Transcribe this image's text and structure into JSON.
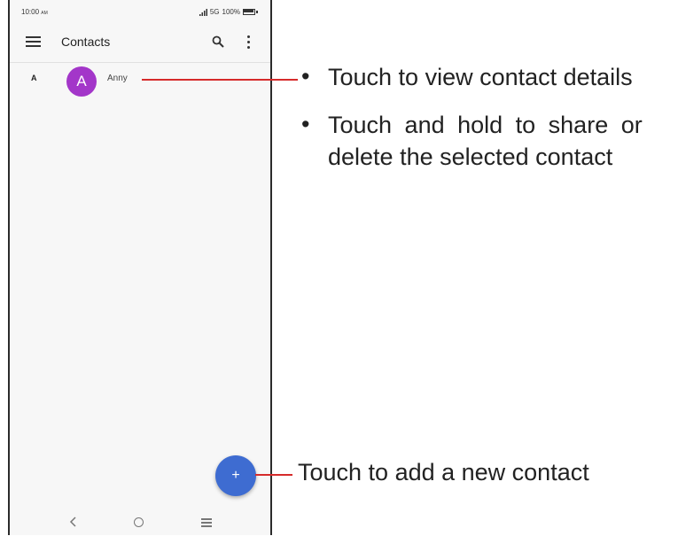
{
  "status_bar": {
    "time": "10:00",
    "time_suffix": "AM",
    "network": "5G",
    "battery": "100%"
  },
  "app_bar": {
    "title": "Contacts",
    "menu_icon": "hamburger-menu-icon",
    "search_icon": "search-icon",
    "overflow_icon": "more-vertical-icon"
  },
  "contacts": [
    {
      "section": "A",
      "initial": "A",
      "name": "Anny",
      "avatar_color": "#a336c9"
    }
  ],
  "fab": {
    "label": "+",
    "color": "#3e6cd1"
  },
  "nav_bar": {
    "back": "‹",
    "home_icon": "home-circle-icon",
    "recents_icon": "recents-icon"
  },
  "callouts": {
    "line_color": "#d62b2b",
    "contact_bullets": [
      "Touch to view contact details",
      "Touch and hold to share or",
      "delete the selected contact"
    ],
    "fab_note": "Touch to add a new contact"
  }
}
